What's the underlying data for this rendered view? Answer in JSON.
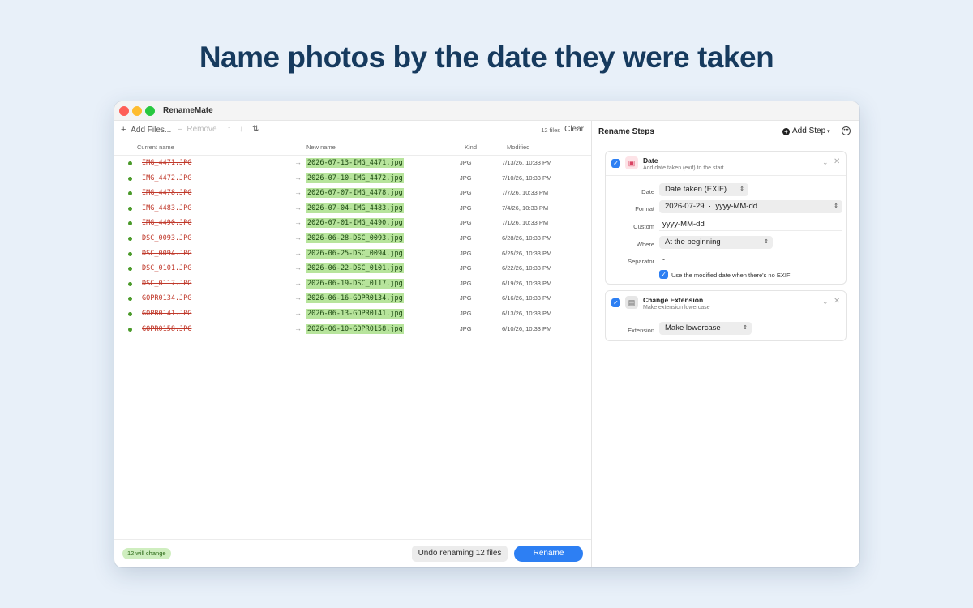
{
  "headline": "Name photos by the date they were taken",
  "window": {
    "title": "RenameMate"
  },
  "toolbar": {
    "add_files": "Add Files...",
    "remove": "Remove",
    "files_count": "12 files",
    "clear": "Clear"
  },
  "columns": {
    "current": "Current name",
    "new": "New name",
    "kind": "Kind",
    "modified": "Modified"
  },
  "files": [
    {
      "old": "IMG_4471.JPG",
      "new": "2026-07-13-IMG_4471.jpg",
      "kind": "JPG",
      "modified": "7/13/26, 10:33 PM"
    },
    {
      "old": "IMG_4472.JPG",
      "new": "2026-07-10-IMG_4472.jpg",
      "kind": "JPG",
      "modified": "7/10/26, 10:33 PM"
    },
    {
      "old": "IMG_4478.JPG",
      "new": "2026-07-07-IMG_4478.jpg",
      "kind": "JPG",
      "modified": "7/7/26, 10:33 PM"
    },
    {
      "old": "IMG_4483.JPG",
      "new": "2026-07-04-IMG_4483.jpg",
      "kind": "JPG",
      "modified": "7/4/26, 10:33 PM"
    },
    {
      "old": "IMG_4490.JPG",
      "new": "2026-07-01-IMG_4490.jpg",
      "kind": "JPG",
      "modified": "7/1/26, 10:33 PM"
    },
    {
      "old": "DSC_0093.JPG",
      "new": "2026-06-28-DSC_0093.jpg",
      "kind": "JPG",
      "modified": "6/28/26, 10:33 PM"
    },
    {
      "old": "DSC_0094.JPG",
      "new": "2026-06-25-DSC_0094.jpg",
      "kind": "JPG",
      "modified": "6/25/26, 10:33 PM"
    },
    {
      "old": "DSC_0101.JPG",
      "new": "2026-06-22-DSC_0101.jpg",
      "kind": "JPG",
      "modified": "6/22/26, 10:33 PM"
    },
    {
      "old": "DSC_0117.JPG",
      "new": "2026-06-19-DSC_0117.jpg",
      "kind": "JPG",
      "modified": "6/19/26, 10:33 PM"
    },
    {
      "old": "GOPR0134.JPG",
      "new": "2026-06-16-GOPR0134.jpg",
      "kind": "JPG",
      "modified": "6/16/26, 10:33 PM"
    },
    {
      "old": "GOPR0141.JPG",
      "new": "2026-06-13-GOPR0141.jpg",
      "kind": "JPG",
      "modified": "6/13/26, 10:33 PM"
    },
    {
      "old": "GOPR0158.JPG",
      "new": "2026-06-10-GOPR0158.jpg",
      "kind": "JPG",
      "modified": "6/10/26, 10:33 PM"
    }
  ],
  "bottom": {
    "badge": "12 will change",
    "undo": "Undo renaming 12 files",
    "rename": "Rename"
  },
  "steps_panel": {
    "title": "Rename Steps",
    "add_step": "Add Step",
    "date_step": {
      "title": "Date",
      "subtitle": "Add date taken (exif) to the start",
      "date_label": "Date",
      "date_value": "Date taken (EXIF)",
      "format_label": "Format",
      "format_value": "2026-07-29  ·  yyyy-MM-dd",
      "custom_label": "Custom",
      "custom_value": "yyyy-MM-dd",
      "where_label": "Where",
      "where_value": "At the beginning",
      "separator_label": "Separator",
      "separator_value": "-",
      "option_label": "Use the modified date when there's no EXIF"
    },
    "ext_step": {
      "title": "Change Extension",
      "subtitle": "Make extension lowercase",
      "ext_label": "Extension",
      "ext_value": "Make lowercase"
    }
  },
  "colors": {
    "accent": "#2d7ff3",
    "old_name": "#c0392b",
    "new_name_bg": "#b7e49c",
    "status_dot": "#4a9a2a",
    "headline": "#163a5e"
  }
}
